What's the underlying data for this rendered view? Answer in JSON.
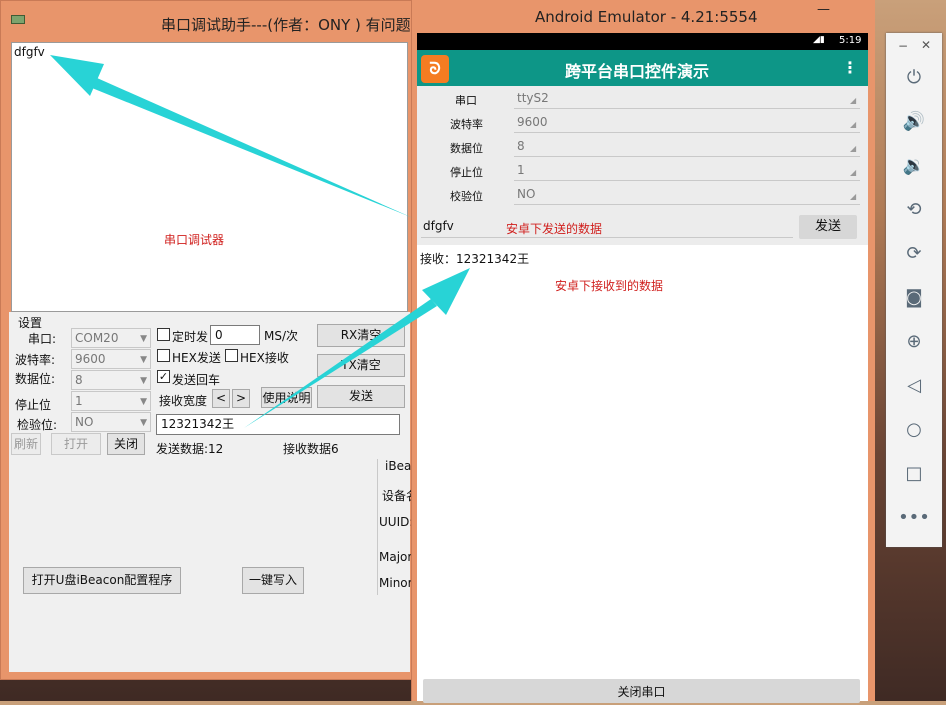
{
  "left_window": {
    "title": "串口调试助手---(作者：ONY ) 有问题",
    "rx_text": "dfgfv",
    "rx_note": "串口调试器",
    "settings": {
      "group_label": "设置",
      "port_label": "串口:",
      "port_value": "COM20",
      "baud_label": "波特率:",
      "baud_value": "9600",
      "databits_label": "数据位:",
      "databits_value": "8",
      "stopbits_label": "停止位",
      "stopbits_value": "1",
      "parity_label": "检验位:",
      "parity_value": "NO"
    },
    "timed_send_label": "定时发",
    "timed_send_value": "0",
    "timed_unit": "MS/次",
    "hex_send_label": "HEX发送",
    "hex_recv_label": "HEX接收",
    "send_cr_label": "发送回车",
    "send_cr_checked": true,
    "recv_width_label": "接收宽度",
    "left_arrow": "<",
    "right_arrow": ">",
    "help_label": "使用说明",
    "rx_clear_label": "RX清空",
    "tx_clear_label": "TX清空",
    "send_label": "发送",
    "send_input_value": "12321342王",
    "refresh_label": "刷新",
    "open_label": "打开",
    "close_label": "关闭",
    "sent_count_label": "发送数据:12",
    "recv_count_label": "接收数据6",
    "open_ibeacon_label": "打开U盘iBeacon配置程序",
    "write_label": "一键写入",
    "ibeacon_labels": [
      "iBea",
      "设备名",
      "UUID:",
      "Major:",
      "Minor:"
    ]
  },
  "emulator": {
    "title": "Android Emulator - 4.21:5554",
    "minimize": "—",
    "status_time": "5:19",
    "app_title": "跨平台串口控件演示",
    "app_icon_glyph": "ᘐ",
    "menu_glyph": "⋮",
    "settings_rows": [
      {
        "label": "串口",
        "value": "ttyS2"
      },
      {
        "label": "波特率",
        "value": "9600"
      },
      {
        "label": "数据位",
        "value": "8"
      },
      {
        "label": "停止位",
        "value": "1"
      },
      {
        "label": "校验位",
        "value": "NO"
      }
    ],
    "send_text": "dfgfv",
    "send_note": "安卓下发送的数据",
    "send_button": "发送",
    "recv_text": "接收：12321342王",
    "recv_note": "安卓下接收到的数据",
    "close_port": "关闭串口"
  },
  "sidebar": {
    "close": "✕",
    "minimize": "−",
    "icons": [
      "power-icon",
      "volume-up-icon",
      "volume-down-icon",
      "rotate-left-icon",
      "rotate-right-icon",
      "camera-icon",
      "zoom-icon",
      "back-icon",
      "home-icon",
      "overview-icon",
      "more-icon"
    ]
  },
  "colors": {
    "window_frame": "#e8956b",
    "android_teal": "#0d9687",
    "annotation_red": "#d0201e",
    "arrow_cyan": "#28d3d6"
  }
}
